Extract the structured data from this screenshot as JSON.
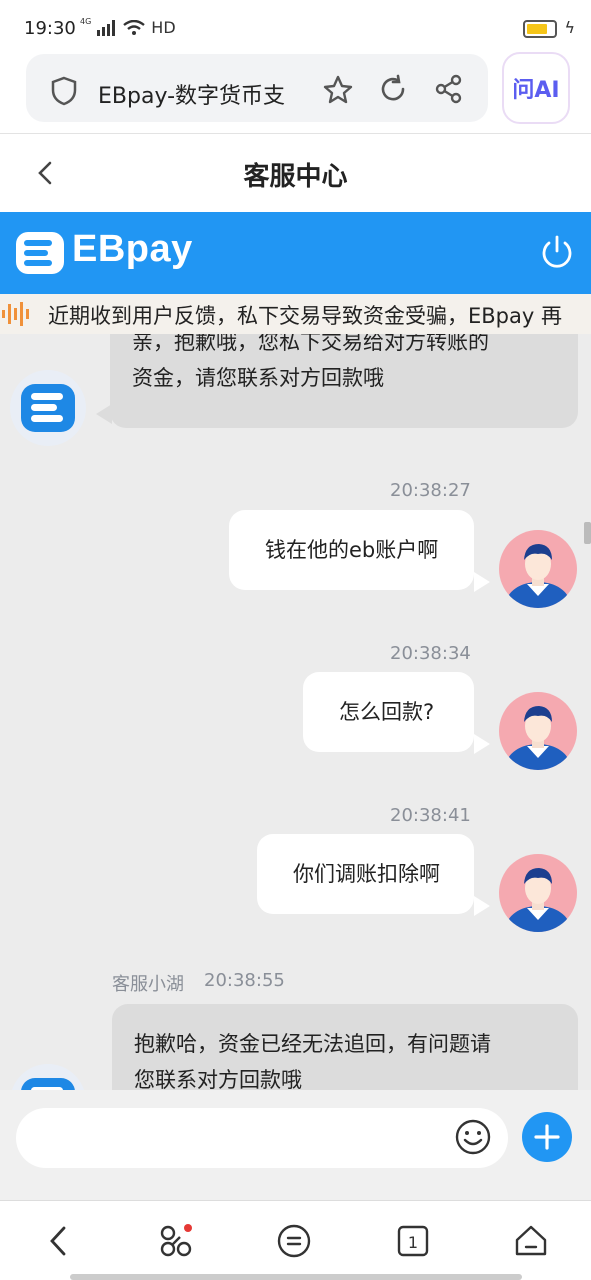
{
  "status_bar": {
    "time": "19:30",
    "network": "4G",
    "hd": "HD",
    "battery_color": "#f5c518"
  },
  "browser": {
    "page_title": "EBpay-数字货币支",
    "ai_label": "问AI"
  },
  "header": {
    "title": "客服中心"
  },
  "brand": {
    "name": "EBpay",
    "bar_color": "#2196f3"
  },
  "notice": {
    "text": "近期收到用户反馈，私下交易导致资金受骗，EBpay 再"
  },
  "messages": [
    {
      "side": "left",
      "line1": "亲，抱歉哦，您私下交易给对方转账的",
      "line2": "资金，请您联系对方回款哦"
    },
    {
      "side": "right",
      "time": "20:38:27",
      "text": "钱在他的eb账户啊"
    },
    {
      "side": "right",
      "time": "20:38:34",
      "text": "怎么回款?"
    },
    {
      "side": "right",
      "time": "20:38:41",
      "text": "你们调账扣除啊"
    },
    {
      "side": "left",
      "sender": "客服小湖",
      "time": "20:38:55",
      "line1": "抱歉哈，资金已经无法追回，有问题请",
      "line2": "您联系对方回款哦"
    }
  ],
  "input": {
    "placeholder": ""
  },
  "icons": {
    "shield": "shield-icon",
    "star": "star-icon",
    "reload": "reload-icon",
    "share": "share-icon",
    "back": "chevron-left-icon",
    "power": "power-icon",
    "emoji": "emoji-icon",
    "plus": "plus-icon",
    "tab_count": "1"
  }
}
